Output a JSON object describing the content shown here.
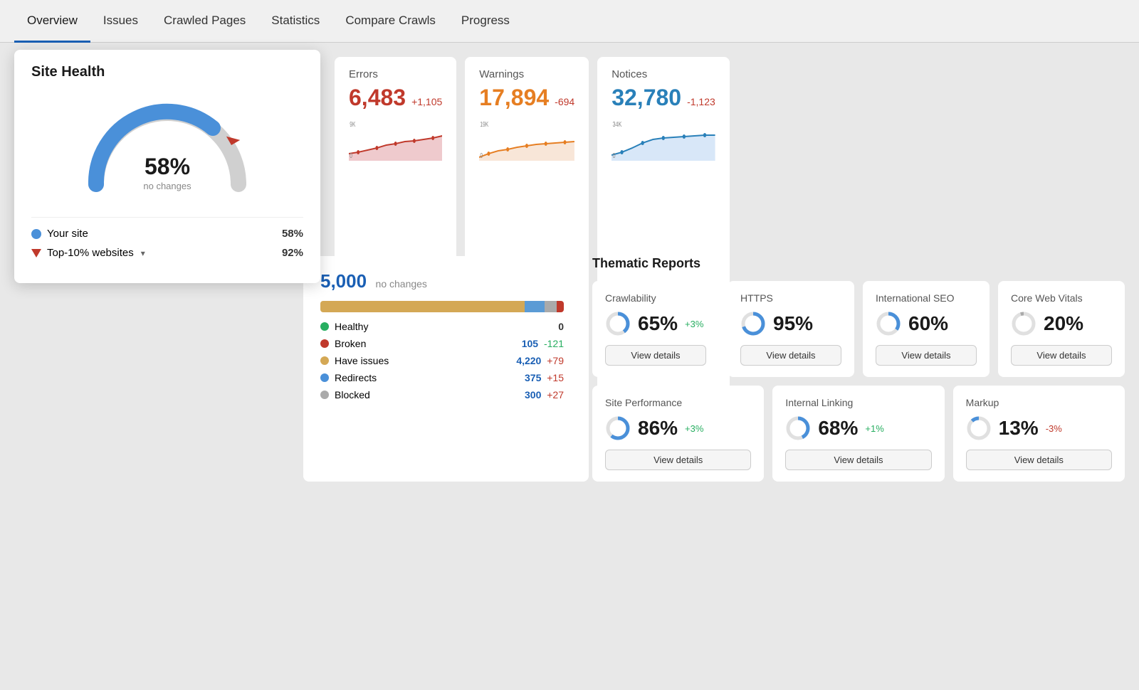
{
  "nav": {
    "items": [
      {
        "label": "Overview",
        "active": true
      },
      {
        "label": "Issues",
        "active": false
      },
      {
        "label": "Crawled Pages",
        "active": false
      },
      {
        "label": "Statistics",
        "active": false
      },
      {
        "label": "Compare Crawls",
        "active": false
      },
      {
        "label": "Progress",
        "active": false
      }
    ]
  },
  "siteHealth": {
    "title": "Site Health",
    "percent": "58%",
    "subtext": "no changes",
    "gaugeFill": 58,
    "legend": [
      {
        "label": "Your site",
        "type": "dot",
        "color": "#4a90d9",
        "value": "58%"
      },
      {
        "label": "Top-10% websites",
        "type": "triangle",
        "color": "#c0392b",
        "value": "92%",
        "hasDropdown": true
      }
    ]
  },
  "metrics": [
    {
      "label": "Errors",
      "value": "6,483",
      "valueClass": "red",
      "change": "+1,105",
      "changeClass": "positive",
      "sparkColor": "#e8b4b8",
      "sparkLineColor": "#c0392b",
      "sparkYHigh": "9K",
      "sparkYLow": "0"
    },
    {
      "label": "Warnings",
      "value": "17,894",
      "valueClass": "orange",
      "change": "-694",
      "changeClass": "negative",
      "sparkColor": "#f5dcc8",
      "sparkLineColor": "#e67e22",
      "sparkYHigh": "19K",
      "sparkYLow": "0"
    },
    {
      "label": "Notices",
      "value": "32,780",
      "valueClass": "blue",
      "change": "-1,123",
      "changeClass": "negative",
      "sparkColor": "#c8ddf5",
      "sparkLineColor": "#2980b9",
      "sparkYHigh": "34K",
      "sparkYLow": "0"
    }
  ],
  "pages": {
    "count": "5,000",
    "subtext": "no changes",
    "bar": [
      {
        "label": "Have issues",
        "color": "#d4a855",
        "pct": 84
      },
      {
        "label": "Redirects",
        "color": "#5b9bd5",
        "pct": 8
      },
      {
        "label": "Blocked",
        "color": "#aaa",
        "pct": 5
      },
      {
        "label": "Broken",
        "color": "#c0392b",
        "pct": 3
      }
    ],
    "legend": [
      {
        "label": "Healthy",
        "color": "#27ae60",
        "value": "0",
        "change": null
      },
      {
        "label": "Broken",
        "color": "#c0392b",
        "value": "105",
        "change": "-121",
        "changeClass": "neg"
      },
      {
        "label": "Have issues",
        "color": "#d4a855",
        "value": "4,220",
        "change": "+79",
        "changeClass": "pos"
      },
      {
        "label": "Redirects",
        "color": "#4a90d9",
        "value": "375",
        "change": "+15",
        "changeClass": "pos"
      },
      {
        "label": "Blocked",
        "color": "#aaa",
        "value": "300",
        "change": "+27",
        "changeClass": "pos"
      }
    ]
  },
  "thematic": {
    "title": "Thematic Reports",
    "topRow": [
      {
        "label": "Crawlability",
        "pct": "65%",
        "change": "+3%",
        "changeClass": "green",
        "donutFill": 65,
        "donutColor": "#4a90d9"
      },
      {
        "label": "HTTPS",
        "pct": "95%",
        "change": null,
        "changeClass": "",
        "donutFill": 95,
        "donutColor": "#4a90d9"
      },
      {
        "label": "International SEO",
        "pct": "60%",
        "change": null,
        "changeClass": "",
        "donutFill": 60,
        "donutColor": "#4a90d9"
      },
      {
        "label": "Core Web Vitals",
        "pct": "20%",
        "change": null,
        "changeClass": "",
        "donutFill": 20,
        "donutColor": "#aaa"
      }
    ],
    "bottomRow": [
      {
        "label": "Site Performance",
        "pct": "86%",
        "change": "+3%",
        "changeClass": "green",
        "donutFill": 86,
        "donutColor": "#4a90d9"
      },
      {
        "label": "Internal Linking",
        "pct": "68%",
        "change": "+1%",
        "changeClass": "green",
        "donutFill": 68,
        "donutColor": "#4a90d9"
      },
      {
        "label": "Markup",
        "pct": "13%",
        "change": "-3%",
        "changeClass": "red",
        "donutFill": 13,
        "donutColor": "#4a90d9"
      }
    ],
    "viewDetailsLabel": "View details"
  }
}
